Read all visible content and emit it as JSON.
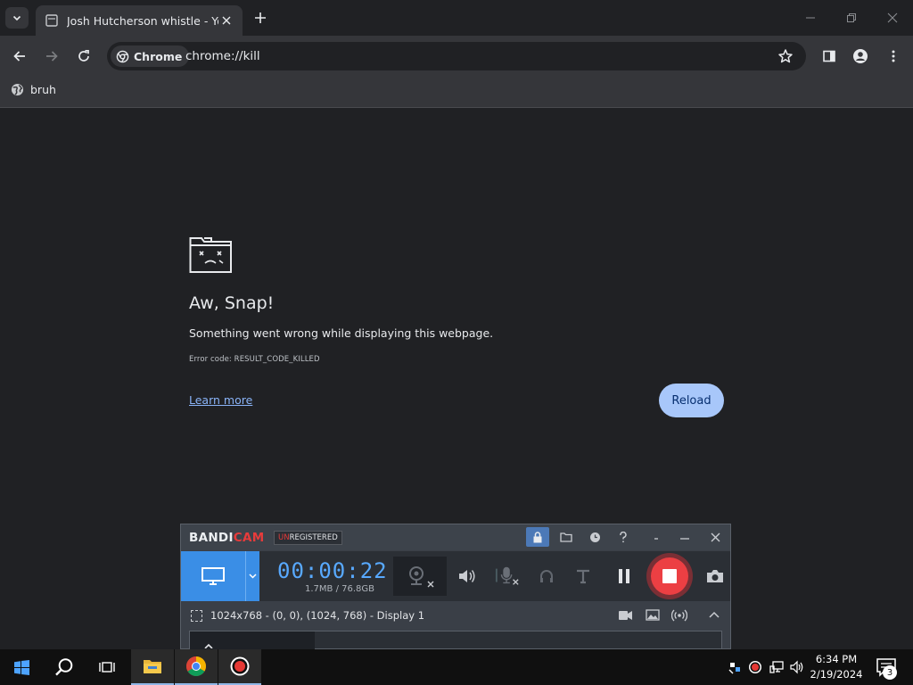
{
  "browser": {
    "tab": {
      "title": "Josh Hutcherson whistle - YouTube"
    },
    "toolbar": {
      "site_chip": "Chrome",
      "url": "chrome://kill"
    },
    "bookmarks": [
      {
        "label": "bruh"
      }
    ]
  },
  "error_page": {
    "title": "Aw, Snap!",
    "message": "Something went wrong while displaying this webpage.",
    "error_code": "Error code: RESULT_CODE_KILLED",
    "learn_more": "Learn more",
    "reload_label": "Reload"
  },
  "bandicam": {
    "logo_main": "BANDI",
    "logo_accent": "CAM",
    "unregistered_prefix": "UN",
    "unregistered_suffix": "REGISTERED",
    "timer": "00:00:22",
    "size": "1.7MB / 76.8GB",
    "region": "1024x768 - (0, 0), (1024, 768) - Display 1"
  },
  "taskbar": {
    "time": "6:34 PM",
    "date": "2/19/2024",
    "notification_count": "3"
  },
  "colors": {
    "reload_button": "#a8c7fa",
    "link": "#8ab4f8",
    "bandicam_accent": "#3a8ee6",
    "record_stop": "#ec3f43"
  }
}
